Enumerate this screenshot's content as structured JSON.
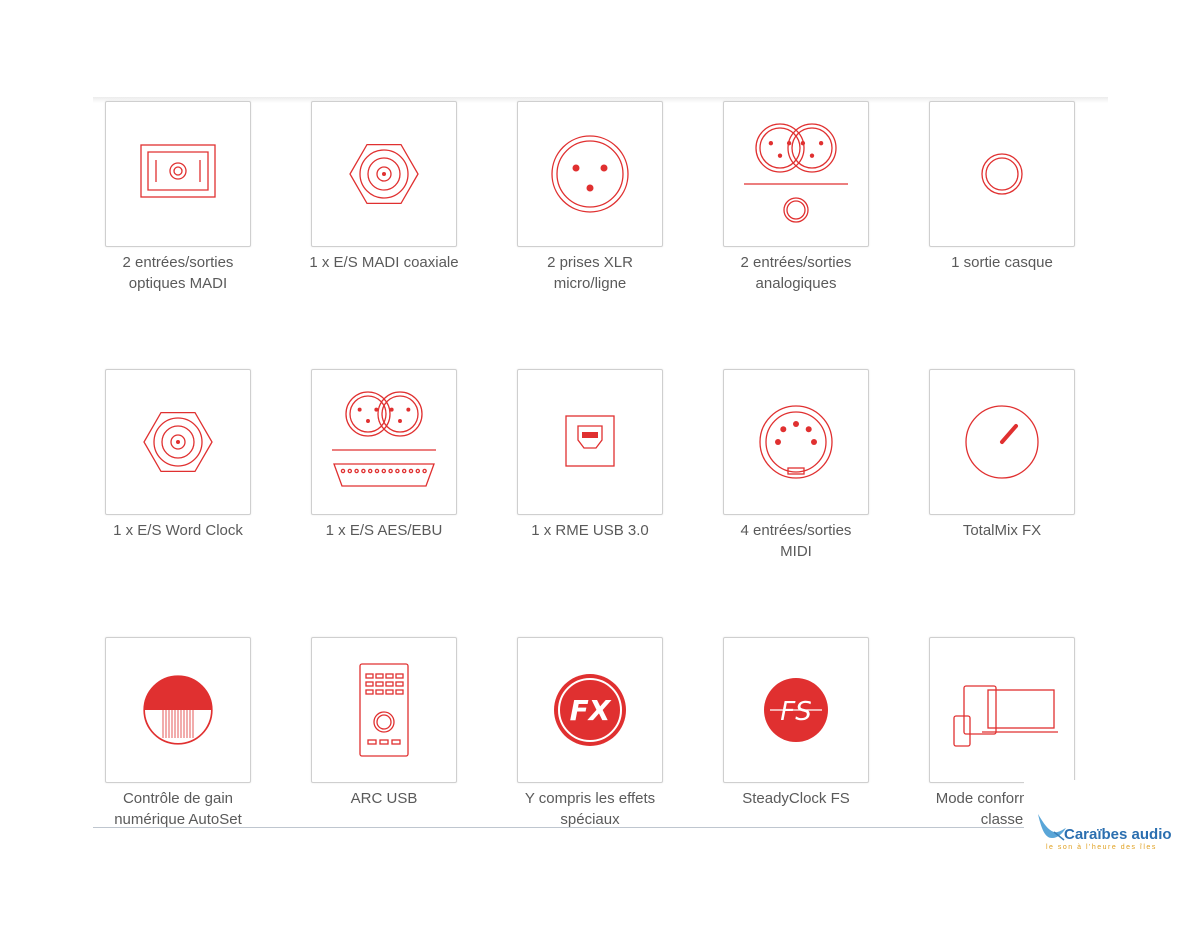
{
  "colors": {
    "accent": "#e03030",
    "border": "#cfcfcf",
    "text": "#5a5a5a"
  },
  "tiles": [
    {
      "icon": "madi-optical-icon",
      "lines": [
        "2 entrées/sorties",
        "optiques MADI"
      ]
    },
    {
      "icon": "bnc-coaxial-icon",
      "lines": [
        "1 x E/S MADI coaxiale"
      ]
    },
    {
      "icon": "xlr-icon",
      "lines": [
        "2 prises XLR",
        "micro/ligne"
      ]
    },
    {
      "icon": "analog-io-icon",
      "lines": [
        "2 entrées/sorties",
        "analogiques"
      ]
    },
    {
      "icon": "headphone-jack-icon",
      "lines": [
        "1 sortie casque"
      ]
    },
    {
      "icon": "word-clock-bnc-icon",
      "lines": [
        "1 x E/S Word Clock"
      ]
    },
    {
      "icon": "aes-ebu-icon",
      "lines": [
        "1 x E/S AES/EBU"
      ]
    },
    {
      "icon": "usb-icon",
      "lines": [
        "1 x RME USB 3.0"
      ]
    },
    {
      "icon": "midi-din-icon",
      "lines": [
        "4 entrées/sorties",
        "MIDI"
      ]
    },
    {
      "icon": "totalmix-knob-icon",
      "lines": [
        "TotalMix FX"
      ]
    },
    {
      "icon": "autoset-gain-icon",
      "lines": [
        "Contrôle de gain",
        "numérique AutoSet"
      ]
    },
    {
      "icon": "arc-usb-remote-icon",
      "lines": [
        "ARC USB"
      ]
    },
    {
      "icon": "fx-badge-icon",
      "icon_text": "FX",
      "lines": [
        "Y compris les effets",
        "spéciaux"
      ]
    },
    {
      "icon": "steadyclock-fs-icon",
      "icon_text": "FS",
      "lines": [
        "SteadyClock FS"
      ]
    },
    {
      "icon": "class-compliant-devices-icon",
      "lines": [
        "Mode conforme à la",
        "classe"
      ]
    }
  ],
  "watermark": {
    "brand": "Caraïbes audio",
    "tagline": "le son à l'heure des îles"
  }
}
